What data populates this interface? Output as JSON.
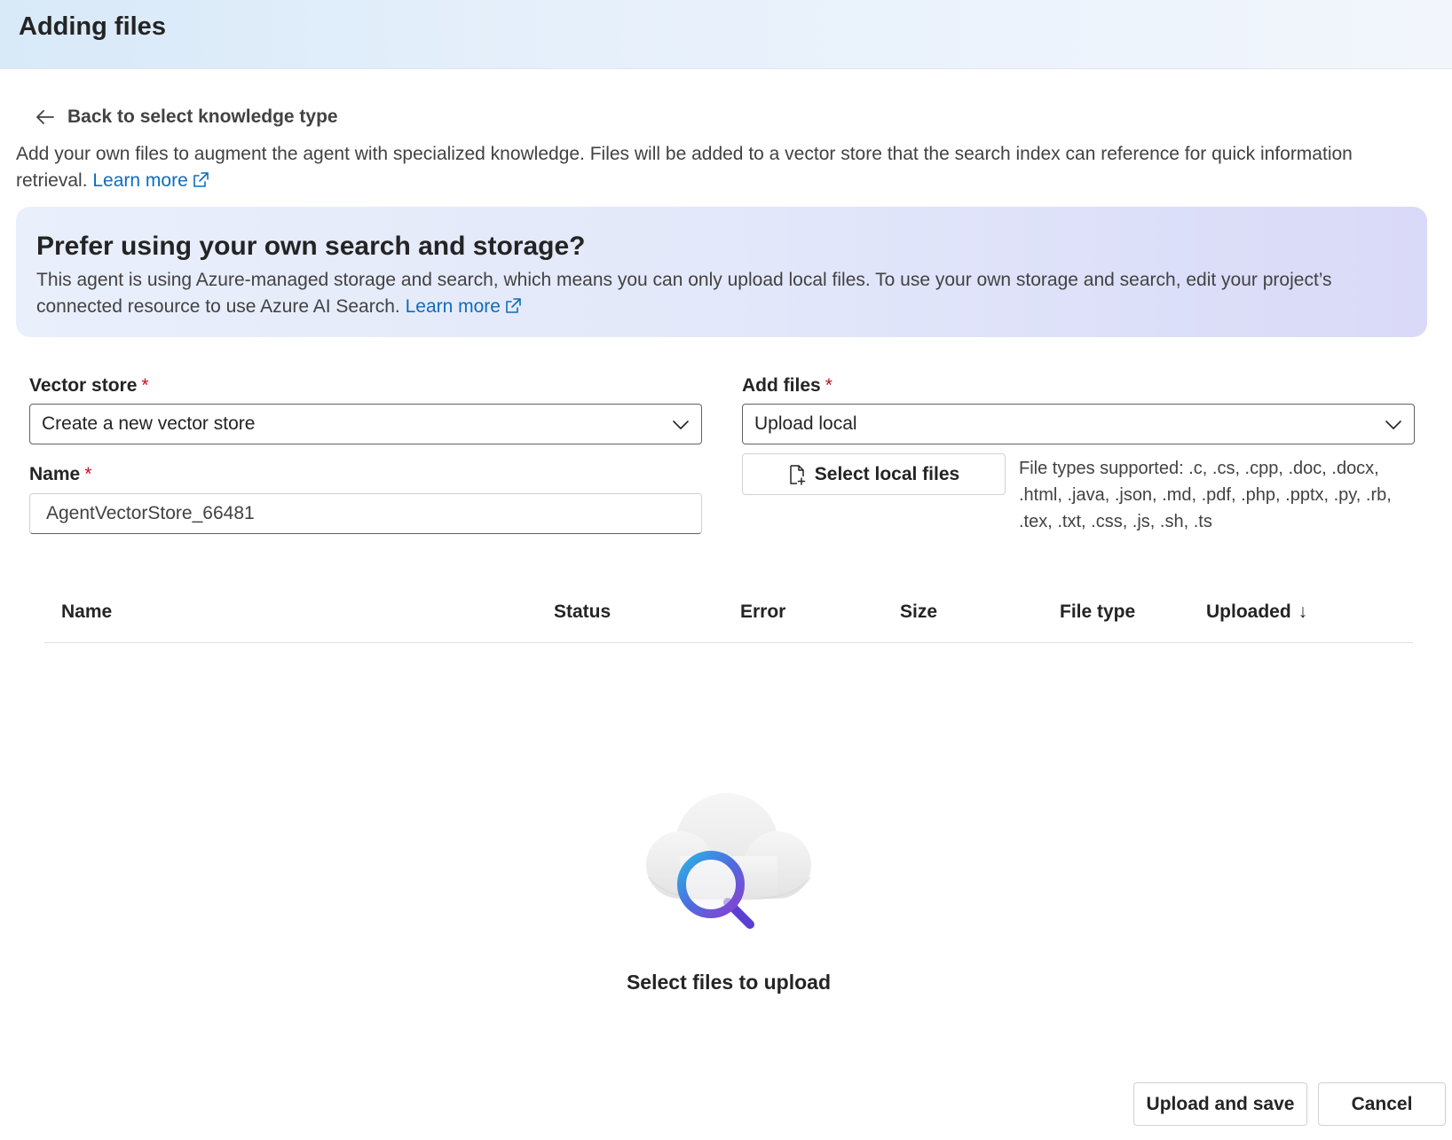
{
  "header": {
    "title": "Adding files"
  },
  "back_link": {
    "label": "Back to select knowledge type",
    "icon": "arrow-left-icon"
  },
  "intro": {
    "text": "Add your own files to augment the agent with specialized knowledge. Files will be added to a vector store that the search index can reference for quick information retrieval.",
    "learn_more": "Learn more"
  },
  "banner": {
    "title": "Prefer using your own search and storage?",
    "text": "This agent is using Azure-managed storage and search, which means you can only upload local files. To use your own storage and search, edit your project’s connected resource to use Azure AI Search.",
    "learn_more": "Learn more"
  },
  "vector_store": {
    "label": "Vector store",
    "required_mark": "*",
    "selected": "Create a new vector store"
  },
  "name_field": {
    "label": "Name",
    "required_mark": "*",
    "value": "AgentVectorStore_66481"
  },
  "add_files": {
    "label": "Add files",
    "required_mark": "*",
    "selected": "Upload local",
    "select_button": "Select local files",
    "file_types_text": "File types supported: .c, .cs, .cpp, .doc, .docx, .html, .java, .json, .md, .pdf, .php, .pptx, .py, .rb, .tex, .txt, .css, .js, .sh, .ts"
  },
  "table": {
    "columns": [
      "Name",
      "Status",
      "Error",
      "Size",
      "File type",
      "Uploaded"
    ],
    "sort_indicator": "↓"
  },
  "empty_state": {
    "text": "Select files to upload",
    "icon": "cloud-search-icon"
  },
  "footer": {
    "primary": "Upload and save",
    "secondary": "Cancel"
  },
  "colors": {
    "link": "#0f6cbd",
    "required": "#c50f1f"
  }
}
